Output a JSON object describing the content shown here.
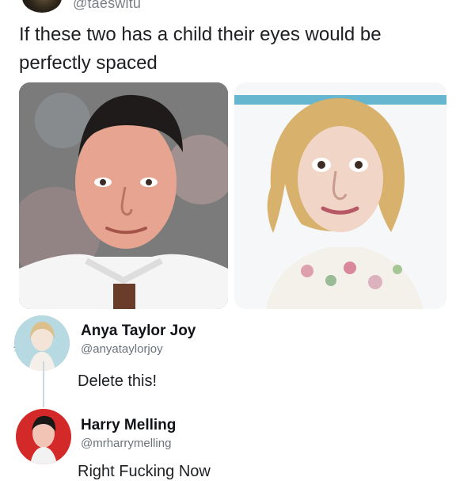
{
  "header": {
    "handle": "@taeswitu",
    "text": "If these two has a child their eyes would be perfectly spaced"
  },
  "replies": [
    {
      "name": "Anya Taylor Joy",
      "handle": "@anyataylorjoy",
      "text": "Delete this!"
    },
    {
      "name": "Harry Melling",
      "handle": "@mrharrymelling",
      "text": "Right Fucking Now"
    }
  ]
}
